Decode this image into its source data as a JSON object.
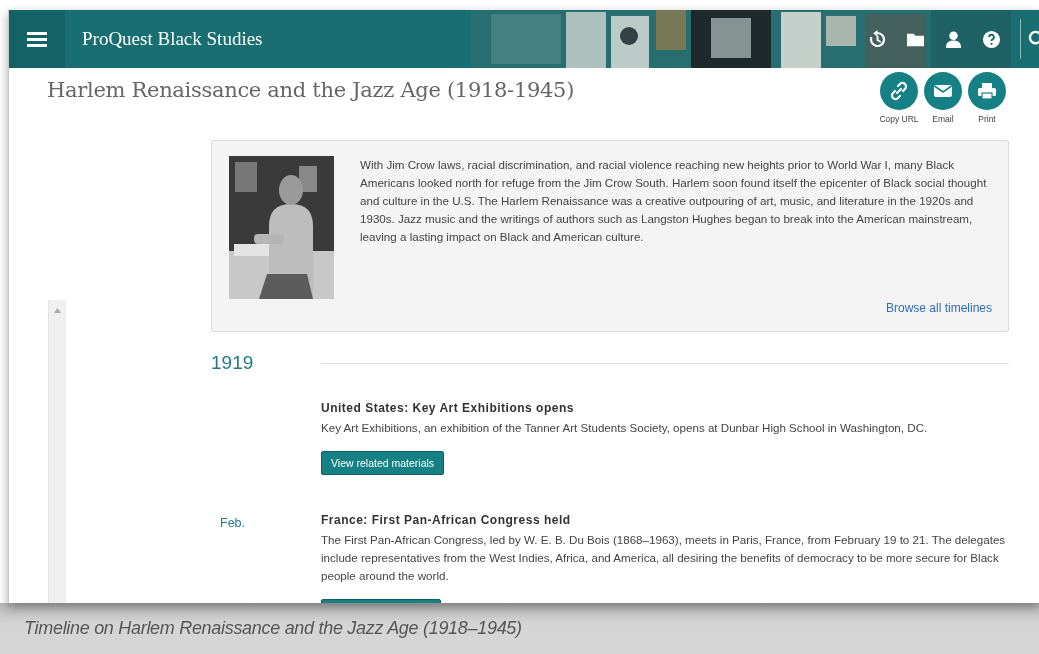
{
  "header": {
    "site_title": "ProQuest Black Studies"
  },
  "page_title": "Harlem Renaissance and the Jazz Age (1918-1945)",
  "actions": [
    {
      "kind": "link",
      "label": "Copy URL"
    },
    {
      "kind": "email",
      "label": "Email"
    },
    {
      "kind": "print",
      "label": "Print"
    }
  ],
  "intro": {
    "text": "With Jim Crow laws, racial discrimination, and racial violence reaching new heights prior to World War I, many Black Americans looked north for refuge from the Jim Crow South. Harlem soon found itself the epicenter of Black social thought and culture in the U.S. The Harlem Renaissance was a creative outpouring of art, music, and literature in the 1920s and 1930s. Jazz music and the writings of authors such as Langston Hughes began to break into the American mainstream, leaving a lasting impact on Black and American culture.",
    "link": "Browse all timelines"
  },
  "timeline": [
    {
      "year": "1919",
      "entries": [
        {
          "title": "United States: Key Art Exhibitions opens",
          "description": "Key Art Exhibitions, an exhibition of the Tanner Art Students Society, opens at Dunbar High School in Washington, DC.",
          "button": "View related materials"
        },
        {
          "date": "Feb.",
          "title": "France: First Pan-African Congress held",
          "description": "The First Pan-African Congress, led by W. E. B. Du Bois (1868–1963), meets in Paris, France, from February 19 to 21. The delegates include representatives from the West Indies, Africa, and America, all desiring the benefits of democracy to be more secure for Black people around the world."
        }
      ]
    }
  ],
  "caption": "Timeline on Harlem Renaissance and the Jazz Age (1918–1945)"
}
